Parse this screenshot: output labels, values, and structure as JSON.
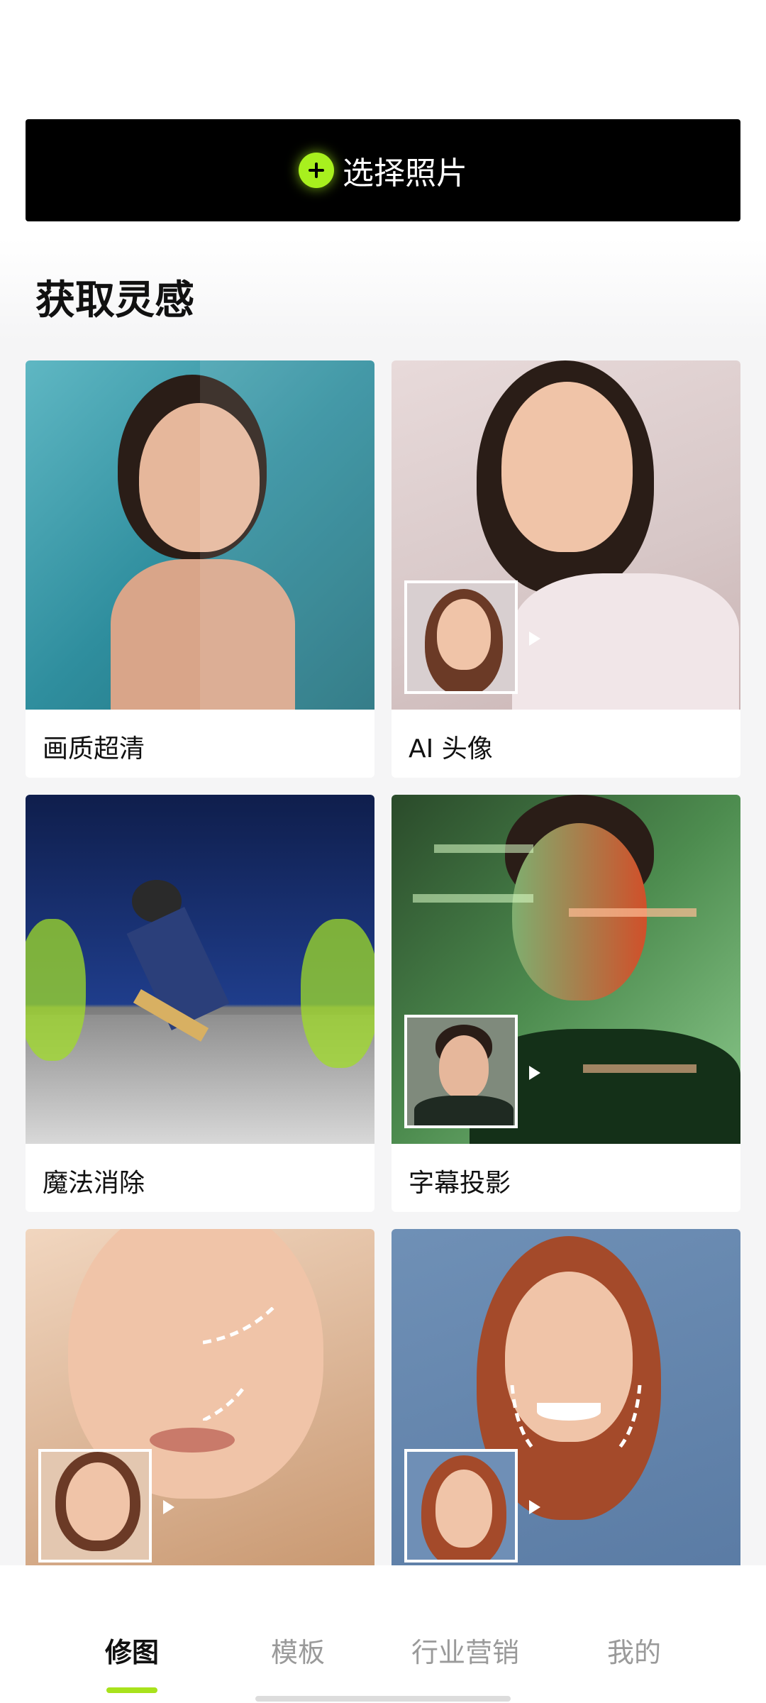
{
  "select_button": {
    "label": "选择照片",
    "icon": "plus-circle-icon",
    "accent": "#a8f01e"
  },
  "section": {
    "title": "获取灵感"
  },
  "cards": [
    {
      "label": "画质超清"
    },
    {
      "label": "AI 头像"
    },
    {
      "label": "魔法消除"
    },
    {
      "label": "字幕投影"
    },
    {
      "label": ""
    },
    {
      "label": ""
    }
  ],
  "tabs": [
    {
      "label": "修图",
      "active": true
    },
    {
      "label": "模板",
      "active": false
    },
    {
      "label": "行业营销",
      "active": false
    },
    {
      "label": "我的",
      "active": false
    }
  ],
  "colors": {
    "accent": "#a8e21c",
    "button_bg": "#000000"
  }
}
